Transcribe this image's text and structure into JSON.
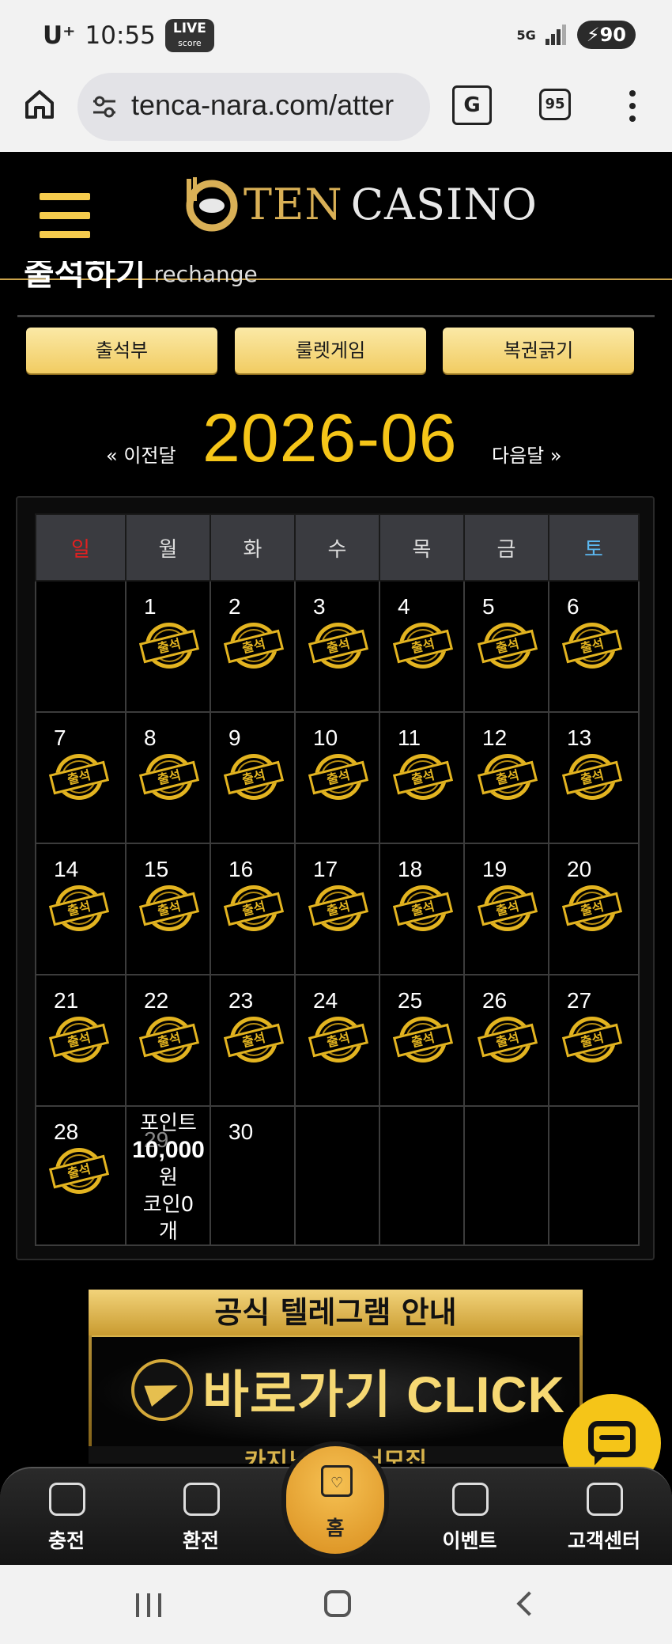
{
  "status_bar": {
    "carrier": "U⁺",
    "time": "10:55",
    "live_badge": "LIVE",
    "live_sub": "score",
    "network": "5G",
    "battery": "90"
  },
  "browser": {
    "url": "tenca-nara.com/atter",
    "translate_label": "G",
    "tab_count": "95"
  },
  "site": {
    "logo_ten": "TEN",
    "logo_casino": "CASINO",
    "page_heading_ko": "출석하기",
    "page_heading_en": "rechange",
    "tabs": [
      {
        "label": "출석부"
      },
      {
        "label": "룰렛게임"
      },
      {
        "label": "복권긁기"
      }
    ]
  },
  "calendar": {
    "prev_label": "« 이전달",
    "month": "2026-06",
    "next_label": "다음달 »",
    "weekdays": [
      "일",
      "월",
      "화",
      "수",
      "목",
      "금",
      "토"
    ],
    "stamp_label": "출석",
    "days": {
      "d1": "1",
      "d2": "2",
      "d3": "3",
      "d4": "4",
      "d5": "5",
      "d6": "6",
      "d7": "7",
      "d8": "8",
      "d9": "9",
      "d10": "10",
      "d11": "11",
      "d12": "12",
      "d13": "13",
      "d14": "14",
      "d15": "15",
      "d16": "16",
      "d17": "17",
      "d18": "18",
      "d19": "19",
      "d20": "20",
      "d21": "21",
      "d22": "22",
      "d23": "23",
      "d24": "24",
      "d25": "25",
      "d26": "26",
      "d27": "27",
      "d28": "28",
      "d29": "29",
      "d30": "30"
    },
    "reward": {
      "point_label": "포인트",
      "point_value": "10,000",
      "point_unit": "원",
      "coin_label": "코인0",
      "coin_unit": "개"
    }
  },
  "banner": {
    "top_text": "공식 텔레그램 안내",
    "main_text": "바로가기 CLICK",
    "bottom_text": "카지노 파트너모집"
  },
  "bottom_nav": {
    "items": [
      {
        "label": "충전"
      },
      {
        "label": "환전"
      },
      {
        "label": "홈"
      },
      {
        "label": "이벤트"
      },
      {
        "label": "고객센터"
      }
    ]
  },
  "colors": {
    "accent_gold": "#f5c518",
    "sunday": "#e22020",
    "saturday": "#5bb7f0"
  }
}
